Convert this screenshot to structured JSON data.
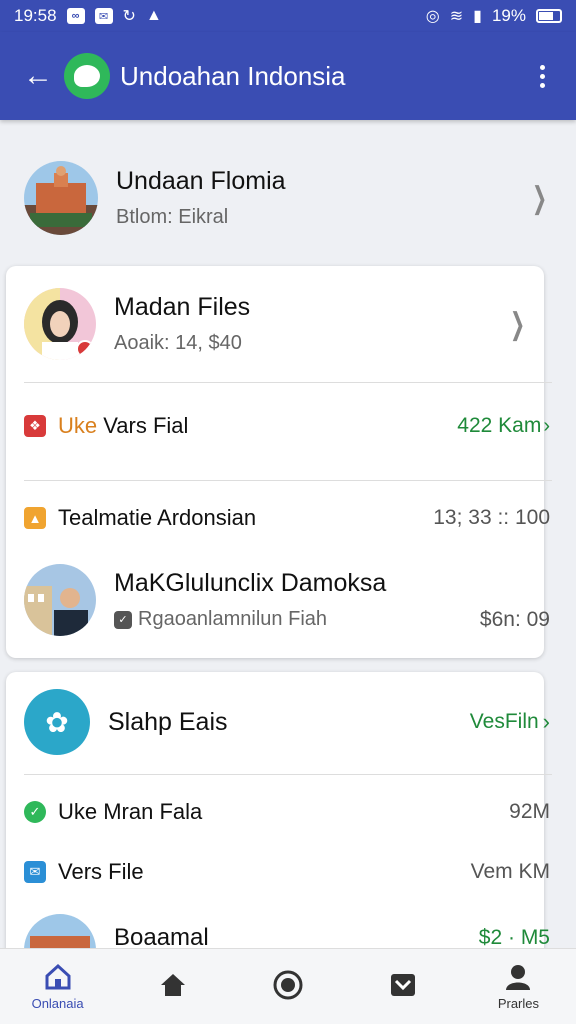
{
  "status_bar": {
    "time": "19:58",
    "battery": "19%"
  },
  "app_bar": {
    "title": "Undoahan Indonsia"
  },
  "top_row": {
    "title": "Undaan Flomia",
    "subtitle": "Btlom: Eikral"
  },
  "card1": {
    "profile": {
      "title": "Madan Files",
      "subtitle": "Aoaik: 14, $40"
    },
    "row_a": {
      "label_prefix": "Uke",
      "label": "Vars Fial",
      "value": "422 Kam",
      "icon_color": "#d83a3a"
    },
    "row_b": {
      "label": "Tealmatie Ardonsian",
      "value": "13; 33 :: 100",
      "icon_color": "#f0a430"
    },
    "profile2": {
      "title": "MaKGlulunclix Damoksa",
      "subtitle": "Rgaoanlamnilun Fiah",
      "value": "$6n: 09"
    }
  },
  "card2": {
    "header": {
      "title": "Slahp Eais",
      "value": "VesFiln"
    },
    "row_a": {
      "label": "Uke Mran Fala",
      "value": "92M",
      "icon_color": "#2fb85a"
    },
    "row_b": {
      "label": "Vers File",
      "value": "Vem KM",
      "icon_color": "#2b8fd6"
    },
    "row_c": {
      "label": "Boaamal",
      "value": "$2 · M5"
    }
  },
  "bottom_nav": {
    "items": [
      {
        "label": "Onlanaia"
      },
      {
        "label": ""
      },
      {
        "label": ""
      },
      {
        "label": ""
      },
      {
        "label": "Prarles"
      }
    ]
  }
}
